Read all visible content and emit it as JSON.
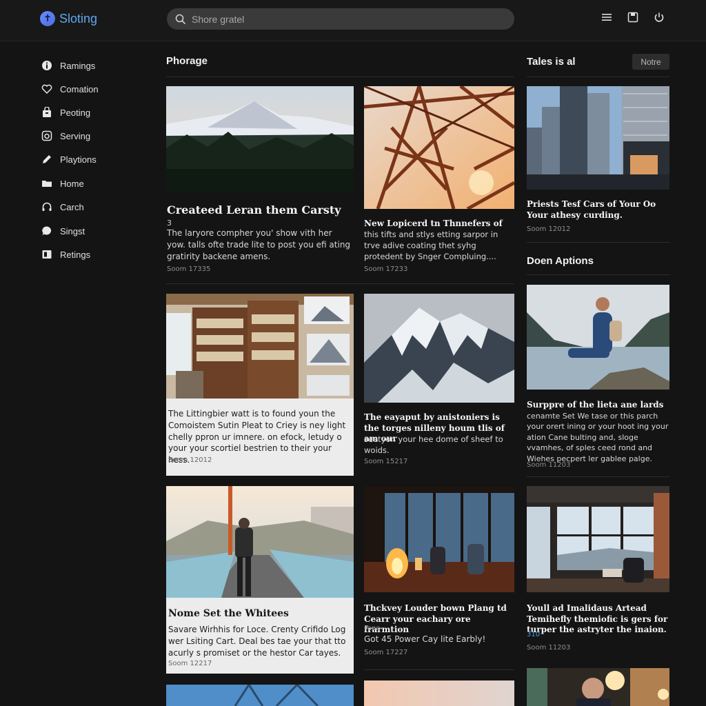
{
  "app": {
    "name": "Sloting"
  },
  "search": {
    "placeholder": "Shore gratel",
    "value": ""
  },
  "toolbar": {
    "icons": [
      "menu-icon",
      "save-icon",
      "power-icon"
    ]
  },
  "sidebar": {
    "items": [
      {
        "label": "Ramings",
        "icon": "info-icon"
      },
      {
        "label": "Comation",
        "icon": "heart-icon"
      },
      {
        "label": "Peoting",
        "icon": "bag-icon"
      },
      {
        "label": "Serving",
        "icon": "camera-icon"
      },
      {
        "label": "Playtions",
        "icon": "pen-icon"
      },
      {
        "label": "Home",
        "icon": "folder-icon"
      },
      {
        "label": "Carch",
        "icon": "headphones-icon"
      },
      {
        "label": "Singst",
        "icon": "chat-icon"
      },
      {
        "label": "Retings",
        "icon": "book-icon"
      }
    ]
  },
  "main": {
    "section_title": "Phorage",
    "right_section_title": "Tales is al",
    "note_button": "Notre",
    "right_section2_title": "Doen Aptions",
    "cards": [
      {
        "title": "Createed Leran them Carsty",
        "subtitle": "3",
        "body": "The laryore compher you' show vith her yow. talls ofte trade lite to post you efi ating gratirity backene amens.",
        "meta": "Soom 17335",
        "image": "mountain-forest"
      },
      {
        "title": "New Lopicerd tn Thnnefers of",
        "body": "this tifts and stlys etting sarpor in trve adive coating thet syhg protedent by Snger Compluing....",
        "meta": "Soom 17233",
        "image": "steel-tower"
      },
      {
        "title": "Priests Tesf Cars of Your Oo Your athesy curding.",
        "meta": "Soom 12012",
        "image": "city-skyscrapers"
      },
      {
        "body": "The Littingbier watt is to found youn the Comoistem Sutin Pleat to Criey is ney light chelly ppron ur imnere. on efock, letudy o your your scortiel bestrien to their your hess.",
        "meta": "Soom 12012",
        "image": "bookshelf-room"
      },
      {
        "title": "The eayaput by anistoniers is the torges nilleny houm tlis of am our",
        "body": "seetyon your hee dome of sheef to woids.",
        "meta": "Soom 15217",
        "image": "snowy-peak"
      },
      {
        "title": "Surppre of the lieta ane lards",
        "body": "cenamte Set We tase or this parch your orert ining or your hoot ing your ation Cane bulting and, sloge vvamhes, of sples ceed rond and Wiehes pecpert ler gablee palge.",
        "meta": "Soom 11203",
        "image": "hiker-lake"
      },
      {
        "title": "Nome Set the Whitees",
        "body": "Savare Wirhhis for Loce. Crenty Crifido Log wer Lsiting Cart. Deal bes tae your that tto acurly s promiset or the hestor Car tayes.",
        "meta": "Soom 12217",
        "image": "bridge-walker"
      },
      {
        "title": "Thckvey Louder bown Plang td Cearr your eachary ore frarmtion",
        "subtitle": "Fane",
        "body": "Got 45 Power Cay lite Earbly!",
        "meta": "Soom 17227",
        "image": "cafe-fire"
      },
      {
        "title": "Youll ad Imalidaus Artead Temihefly themiofic is gers for turper the astryter the inaion.",
        "subtitle": "310",
        "meta": "Soom 11203",
        "image": "window-lounge"
      }
    ]
  },
  "colors": {
    "accent": "#5fa8f0",
    "background": "#141414",
    "card_light": "#ececec"
  }
}
